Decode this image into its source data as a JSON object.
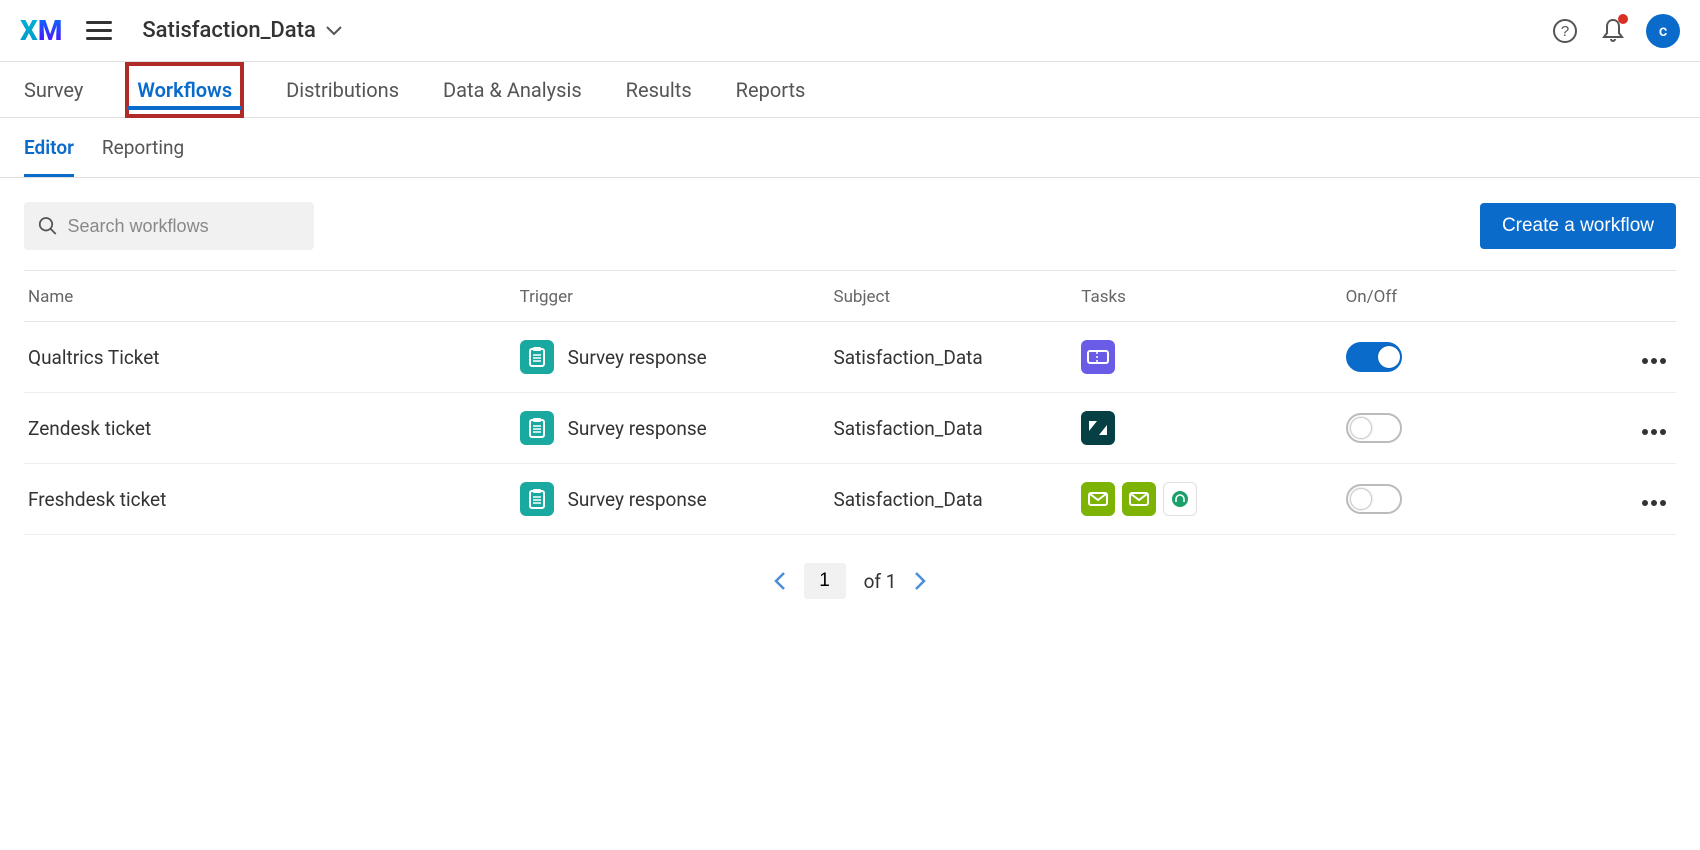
{
  "header": {
    "project_title": "Satisfaction_Data",
    "avatar_initial": "c"
  },
  "main_tabs": [
    {
      "label": "Survey",
      "active": false
    },
    {
      "label": "Workflows",
      "active": true
    },
    {
      "label": "Distributions",
      "active": false
    },
    {
      "label": "Data & Analysis",
      "active": false
    },
    {
      "label": "Results",
      "active": false
    },
    {
      "label": "Reports",
      "active": false
    }
  ],
  "sub_tabs": [
    {
      "label": "Editor",
      "active": true
    },
    {
      "label": "Reporting",
      "active": false
    }
  ],
  "toolbar": {
    "search_placeholder": "Search workflows",
    "create_label": "Create a workflow"
  },
  "table": {
    "headers": {
      "name": "Name",
      "trigger": "Trigger",
      "subject": "Subject",
      "tasks": "Tasks",
      "onoff": "On/Off"
    },
    "rows": [
      {
        "name": "Qualtrics Ticket",
        "trigger": "Survey response",
        "subject": "Satisfaction_Data",
        "on": true,
        "tasks": [
          "ticket-purple"
        ]
      },
      {
        "name": "Zendesk ticket",
        "trigger": "Survey response",
        "subject": "Satisfaction_Data",
        "on": false,
        "tasks": [
          "zendesk"
        ]
      },
      {
        "name": "Freshdesk ticket",
        "trigger": "Survey response",
        "subject": "Satisfaction_Data",
        "on": false,
        "tasks": [
          "email-olive",
          "email-olive",
          "freshdesk"
        ]
      }
    ]
  },
  "pagination": {
    "current": "1",
    "of_label": "of 1"
  }
}
